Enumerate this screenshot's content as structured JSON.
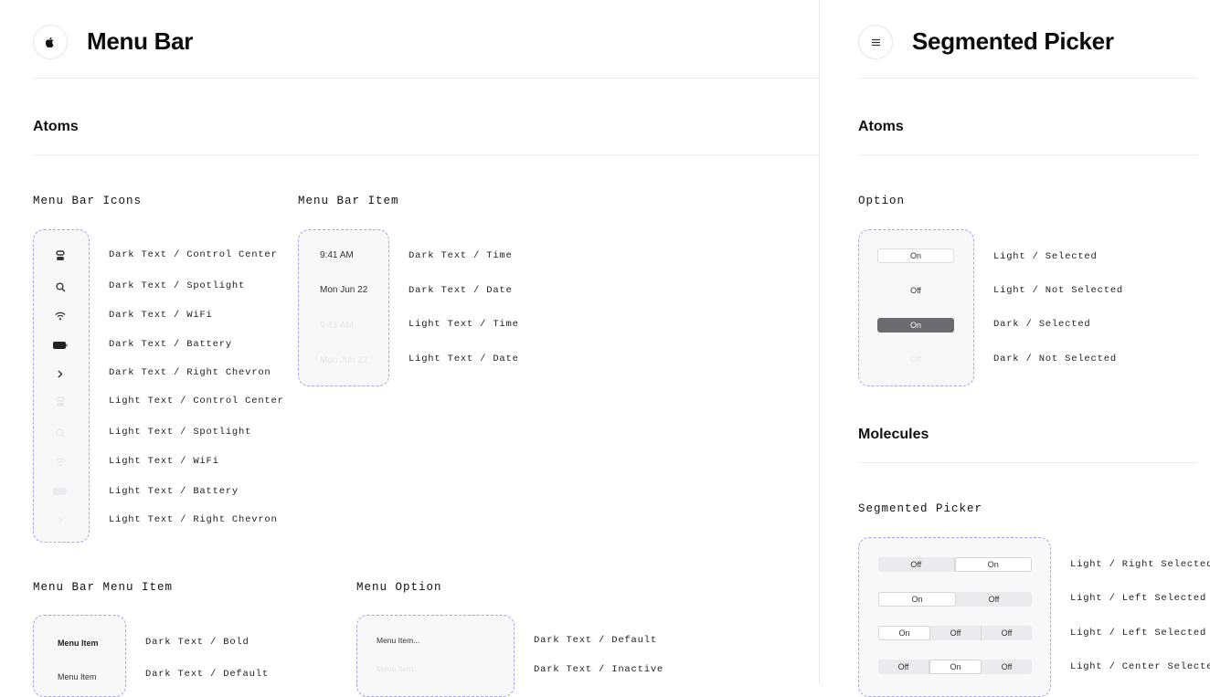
{
  "menu_bar": {
    "title": "Menu Bar",
    "logo_icon": "apple-logo-icon",
    "atoms_title": "Atoms",
    "icons_group": {
      "title": "Menu Bar Icons",
      "items": [
        {
          "icon": "control-center-icon",
          "label": "Dark Text / Control Center"
        },
        {
          "icon": "spotlight-icon",
          "label": "Dark Text / Spotlight"
        },
        {
          "icon": "wifi-icon",
          "label": "Dark Text / WiFi"
        },
        {
          "icon": "battery-icon",
          "label": "Dark Text / Battery"
        },
        {
          "icon": "chevron-right-icon",
          "label": "Dark Text / Right Chevron"
        },
        {
          "icon": "control-center-icon",
          "label": "Light Text / Control Center"
        },
        {
          "icon": "spotlight-icon",
          "label": "Light Text / Spotlight"
        },
        {
          "icon": "wifi-icon",
          "label": "Light Text / WiFi"
        },
        {
          "icon": "battery-icon",
          "label": "Light Text / Battery"
        },
        {
          "icon": "chevron-right-icon",
          "label": "Light Text / Right Chevron"
        }
      ]
    },
    "item_group": {
      "title": "Menu Bar Item",
      "items": [
        {
          "text": "9:41 AM",
          "label": "Dark Text / Time"
        },
        {
          "text": "Mon Jun 22",
          "label": "Dark Text / Date"
        },
        {
          "text": "9:41 AM",
          "label": "Light Text / Time"
        },
        {
          "text": "Mon Jun 22",
          "label": "Light Text / Date"
        }
      ]
    },
    "menu_item_group": {
      "title": "Menu Bar Menu Item",
      "items": [
        {
          "text": "Menu Item",
          "label": "Dark Text / Bold"
        },
        {
          "text": "Menu Item",
          "label": "Dark Text / Default"
        }
      ]
    },
    "menu_option_group": {
      "title": "Menu Option",
      "items": [
        {
          "text": "Menu Item...",
          "label": "Dark Text / Default"
        },
        {
          "text": "Menu Item...",
          "label": "Dark Text / Inactive"
        }
      ]
    }
  },
  "segmented_picker": {
    "title": "Segmented Picker",
    "logo_icon": "list-icon",
    "atoms_title": "Atoms",
    "option_group": {
      "title": "Option",
      "items": [
        {
          "text": "On",
          "label": "Light / Selected"
        },
        {
          "text": "Off",
          "label": "Light / Not Selected"
        },
        {
          "text": "On",
          "label": "Dark / Selected"
        },
        {
          "text": "Off",
          "label": "Dark / Not Selected"
        }
      ]
    },
    "molecules_title": "Molecules",
    "picker_group": {
      "title": "Segmented Picker",
      "rows": [
        {
          "segments": [
            "Off",
            "On"
          ],
          "selected": 1,
          "label": "Light / Right Selected"
        },
        {
          "segments": [
            "On",
            "Off"
          ],
          "selected": 0,
          "label": "Light / Left Selected"
        },
        {
          "segments": [
            "On",
            "Off",
            "Off"
          ],
          "selected": 0,
          "label": "Light / Left Selected"
        },
        {
          "segments": [
            "Off",
            "On",
            "Off"
          ],
          "selected": 1,
          "label": "Light / Center Selected"
        }
      ]
    }
  }
}
